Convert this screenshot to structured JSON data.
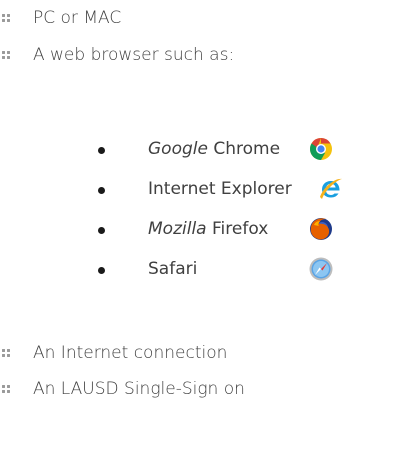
{
  "list": {
    "item1": "PC or MAC",
    "item2": "A web browser such as:",
    "browsers": [
      {
        "italic": "Google",
        "rest": " Chrome",
        "icon": "chrome-icon"
      },
      {
        "italic": "",
        "rest": "Internet Explorer",
        "icon": "internet-explorer-icon"
      },
      {
        "italic": "Mozilla",
        "rest": " Firefox",
        "icon": "firefox-icon"
      },
      {
        "italic": "",
        "rest": "Safari",
        "icon": "safari-icon"
      }
    ],
    "item3": "An Internet connection",
    "item4": "An LAUSD Single-Sign on"
  },
  "colors": {
    "bullet": "#9a9a9a",
    "text": "#404040"
  }
}
